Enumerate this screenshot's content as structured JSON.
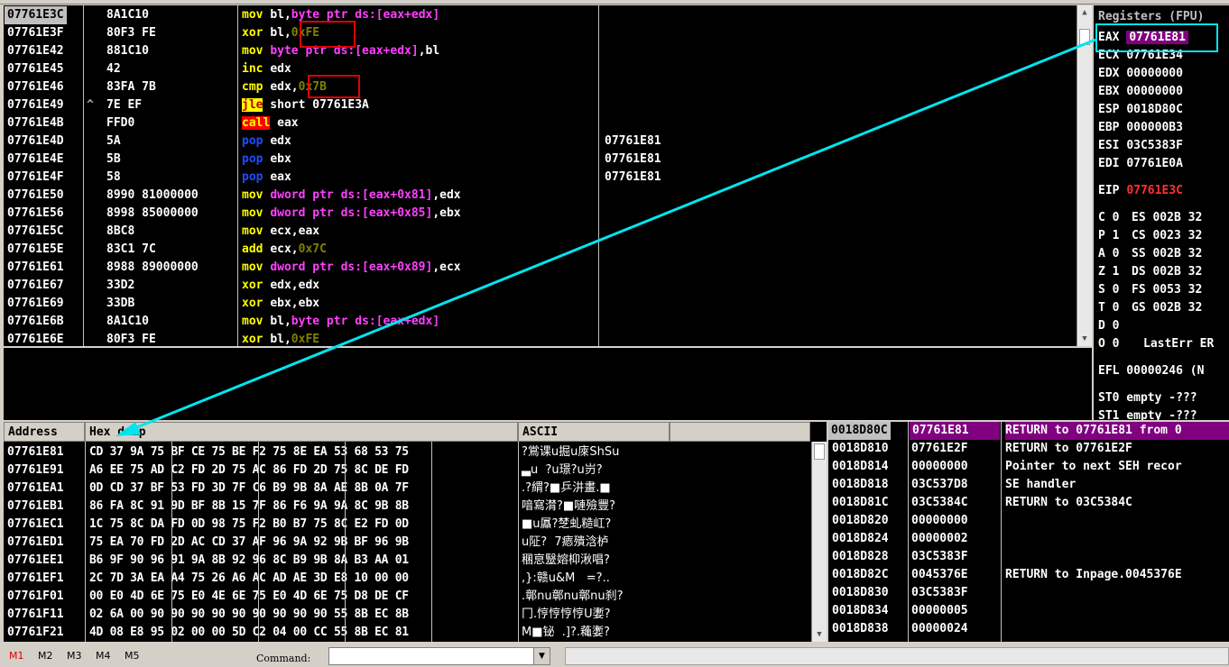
{
  "disasm": {
    "rows": [
      {
        "addr": "07761E3C",
        "hex": "8A1C10",
        "parts": [
          {
            "t": "mov ",
            "c": "c-mn"
          },
          {
            "t": "bl,",
            "c": ""
          },
          {
            "t": "byte ptr ",
            "c": "c-mag"
          },
          {
            "t": "ds:[eax+edx]",
            "c": "c-mag"
          }
        ],
        "comment": ""
      },
      {
        "addr": "07761E3F",
        "hex": "80F3 FE",
        "parts": [
          {
            "t": "xor ",
            "c": "c-mn"
          },
          {
            "t": "bl,",
            "c": ""
          },
          {
            "t": "0xFE",
            "c": "c-imm"
          }
        ],
        "comment": ""
      },
      {
        "addr": "07761E42",
        "hex": "881C10",
        "parts": [
          {
            "t": "mov ",
            "c": "c-mn"
          },
          {
            "t": "byte ptr ds:[eax+edx]",
            "c": "c-mag"
          },
          {
            "t": ",bl",
            "c": ""
          }
        ],
        "comment": ""
      },
      {
        "addr": "07761E45",
        "hex": "42",
        "parts": [
          {
            "t": "inc ",
            "c": "c-mn"
          },
          {
            "t": "edx",
            "c": ""
          }
        ],
        "comment": ""
      },
      {
        "addr": "07761E46",
        "hex": "83FA 7B",
        "parts": [
          {
            "t": "cmp ",
            "c": "c-mn"
          },
          {
            "t": "edx,",
            "c": ""
          },
          {
            "t": "0x7B",
            "c": "c-imm"
          }
        ],
        "comment": ""
      },
      {
        "addr": "07761E49",
        "hex": "7E EF",
        "parts": [
          {
            "t": "jle",
            "c": "jle"
          },
          {
            "t": " short 07761E3A",
            "c": ""
          }
        ],
        "comment": ""
      },
      {
        "addr": "07761E4B",
        "hex": "FFD0",
        "parts": [
          {
            "t": "call",
            "c": "call"
          },
          {
            "t": " eax",
            "c": ""
          }
        ],
        "comment": ""
      },
      {
        "addr": "07761E4D",
        "hex": "5A",
        "parts": [
          {
            "t": "pop ",
            "c": "c-blue"
          },
          {
            "t": "edx",
            "c": ""
          }
        ],
        "comment": "07761E81"
      },
      {
        "addr": "07761E4E",
        "hex": "5B",
        "parts": [
          {
            "t": "pop ",
            "c": "c-blue"
          },
          {
            "t": "ebx",
            "c": ""
          }
        ],
        "comment": "07761E81"
      },
      {
        "addr": "07761E4F",
        "hex": "58",
        "parts": [
          {
            "t": "pop ",
            "c": "c-blue"
          },
          {
            "t": "eax",
            "c": ""
          }
        ],
        "comment": "07761E81"
      },
      {
        "addr": "07761E50",
        "hex": "8990 81000000",
        "parts": [
          {
            "t": "mov ",
            "c": "c-mn"
          },
          {
            "t": "dword ptr ds:[eax+0x81]",
            "c": "c-mag"
          },
          {
            "t": ",edx",
            "c": ""
          }
        ],
        "comment": ""
      },
      {
        "addr": "07761E56",
        "hex": "8998 85000000",
        "parts": [
          {
            "t": "mov ",
            "c": "c-mn"
          },
          {
            "t": "dword ptr ds:[eax+0x85]",
            "c": "c-mag"
          },
          {
            "t": ",ebx",
            "c": ""
          }
        ],
        "comment": ""
      },
      {
        "addr": "07761E5C",
        "hex": "8BC8",
        "parts": [
          {
            "t": "mov ",
            "c": "c-mn"
          },
          {
            "t": "ecx,eax",
            "c": ""
          }
        ],
        "comment": ""
      },
      {
        "addr": "07761E5E",
        "hex": "83C1 7C",
        "parts": [
          {
            "t": "add ",
            "c": "c-mn"
          },
          {
            "t": "ecx,",
            "c": ""
          },
          {
            "t": "0x7C",
            "c": "c-imm"
          }
        ],
        "comment": ""
      },
      {
        "addr": "07761E61",
        "hex": "8988 89000000",
        "parts": [
          {
            "t": "mov ",
            "c": "c-mn"
          },
          {
            "t": "dword ptr ds:[eax+0x89]",
            "c": "c-mag"
          },
          {
            "t": ",ecx",
            "c": ""
          }
        ],
        "comment": ""
      },
      {
        "addr": "07761E67",
        "hex": "33D2",
        "parts": [
          {
            "t": "xor ",
            "c": "c-mn"
          },
          {
            "t": "edx,edx",
            "c": ""
          }
        ],
        "comment": ""
      },
      {
        "addr": "07761E69",
        "hex": "33DB",
        "parts": [
          {
            "t": "xor ",
            "c": "c-mn"
          },
          {
            "t": "ebx,ebx",
            "c": ""
          }
        ],
        "comment": ""
      },
      {
        "addr": "07761E6B",
        "hex": "8A1C10",
        "parts": [
          {
            "t": "mov ",
            "c": "c-mn"
          },
          {
            "t": "bl,",
            "c": ""
          },
          {
            "t": "byte ptr ds:[eax+edx]",
            "c": "c-mag"
          }
        ],
        "comment": ""
      },
      {
        "addr": "07761E6E",
        "hex": "80F3 FE",
        "parts": [
          {
            "t": "xor ",
            "c": "c-mn"
          },
          {
            "t": "bl,",
            "c": ""
          },
          {
            "t": "0xFE",
            "c": "c-imm"
          }
        ],
        "comment": ""
      }
    ],
    "jump_marker": "^"
  },
  "registers": {
    "title": "Registers (FPU)",
    "gp": [
      {
        "name": "EAX",
        "value": "07761E81"
      },
      {
        "name": "ECX",
        "value": "07761E34"
      },
      {
        "name": "EDX",
        "value": "00000000"
      },
      {
        "name": "EBX",
        "value": "00000000"
      },
      {
        "name": "ESP",
        "value": "0018D80C"
      },
      {
        "name": "EBP",
        "value": "000000B3"
      },
      {
        "name": "ESI",
        "value": "03C5383F"
      },
      {
        "name": "EDI",
        "value": "07761E0A"
      }
    ],
    "eip": {
      "name": "EIP",
      "value": "07761E3C"
    },
    "flags": [
      {
        "f": "C 0",
        "seg": "ES 002B 32"
      },
      {
        "f": "P 1",
        "seg": "CS 0023 32"
      },
      {
        "f": "A 0",
        "seg": "SS 002B 32"
      },
      {
        "f": "Z 1",
        "seg": "DS 002B 32"
      },
      {
        "f": "S 0",
        "seg": "FS 0053 32"
      },
      {
        "f": "T 0",
        "seg": "GS 002B 32"
      },
      {
        "f": "D 0",
        "seg": ""
      },
      {
        "f": "O 0",
        "seg": "LastErr ER"
      }
    ],
    "efl": "EFL 00000246 (N",
    "st0": "ST0 empty -???",
    "st1": "ST1 empty -???"
  },
  "dump": {
    "headers": {
      "address": "Address",
      "hex": "Hex dump",
      "ascii": "ASCII"
    },
    "rows": [
      {
        "addr": "07761E81",
        "hex": "CD 37 9A 75 BF CE 75 BE F2 75 8E EA 53 68 53 75",
        "ascii": "?鴬课u掘u庲ShSu"
      },
      {
        "addr": "07761E91",
        "hex": "A6 EE 75 AD C2 FD 2D 75 AC 86 FD 2D 75 8C DE FD",
        "ascii": "▃u  ?u璟?u岃?"
      },
      {
        "addr": "07761EA1",
        "hex": "0D CD 37 BF 53 FD 3D 7F C6 B9 9B 8A AE 8B 0A 7F",
        "ascii": ".?緭?■乒汫畫.■"
      },
      {
        "addr": "07761EB1",
        "hex": "86 FA 8C 91 9D BF 8B 15 7F 86 F6 9A 9A 8C 9B 8B",
        "ascii": "喑寫潸?■嗹殮豐?"
      },
      {
        "addr": "07761EC1",
        "hex": "1C 75 8C DA FD 0D 98 75 F2 B0 B7 75 8C E2 FD 0D",
        "ascii": "■u屭?椘虬糙屸?"
      },
      {
        "addr": "07761ED1",
        "hex": "75 EA 70 FD 2D AC CD 37 AF 96 9A 92 9B BF 96 9B",
        "ascii": "u阷?  7瘱殨浛栌"
      },
      {
        "addr": "07761EE1",
        "hex": "B6 9F 90 96 91 9A 8B 92 96 8C B9 9B 8A B3 AA 01",
        "ascii": "稛恴毉嫆枊湫唱?"
      },
      {
        "addr": "07761EF1",
        "hex": "2C 7D 3A EA A4 75 26 A6 AC AD AE 3D E8 10 00 00",
        "ascii": ",}:赣u&M   =?.."
      },
      {
        "addr": "07761F01",
        "hex": "00 E0 4D 6E 75 E0 4E 6E 75 E0 4D 6E 75 D8 DE CF",
        "ascii": ".鄣nu鄣nu鄣nu刹?"
      },
      {
        "addr": "07761F11",
        "hex": "02 6A 00 90 90 90 90 90 90 90 90 90 55 8B EC 8B",
        "ascii": "冂.悙悙悙悙U嬱?"
      },
      {
        "addr": "07761F21",
        "hex": "4D 08 E8 95 02 00 00 5D C2 04 00 CC 55 8B EC 81",
        "ascii": "M■铋  .]?.蘒嬱?"
      }
    ]
  },
  "stack": {
    "rows": [
      {
        "addr": "0018D80C",
        "val": "07761E81",
        "comment": "RETURN to 07761E81 from 0"
      },
      {
        "addr": "0018D810",
        "val": "07761E2F",
        "comment": "RETURN to 07761E2F"
      },
      {
        "addr": "0018D814",
        "val": "00000000",
        "comment": "Pointer to next SEH recor"
      },
      {
        "addr": "0018D818",
        "val": "03C537D8",
        "comment": "SE handler"
      },
      {
        "addr": "0018D81C",
        "val": "03C5384C",
        "comment": "RETURN to 03C5384C"
      },
      {
        "addr": "0018D820",
        "val": "00000000",
        "comment": ""
      },
      {
        "addr": "0018D824",
        "val": "00000002",
        "comment": ""
      },
      {
        "addr": "0018D828",
        "val": "03C5383F",
        "comment": ""
      },
      {
        "addr": "0018D82C",
        "val": "0045376E",
        "comment": "RETURN to Inpage.0045376E"
      },
      {
        "addr": "0018D830",
        "val": "03C5383F",
        "comment": ""
      },
      {
        "addr": "0018D834",
        "val": "00000005",
        "comment": ""
      },
      {
        "addr": "0018D838",
        "val": "00000024",
        "comment": ""
      }
    ]
  },
  "statusbar": {
    "m_tabs": [
      "M1",
      "M2",
      "M3",
      "M4",
      "M5"
    ],
    "command_label": "Command:",
    "command_value": ""
  },
  "colors": {
    "annotation_arrow": "#00e5ee",
    "annotation_box": "#e00000",
    "highlight": "#800080"
  }
}
